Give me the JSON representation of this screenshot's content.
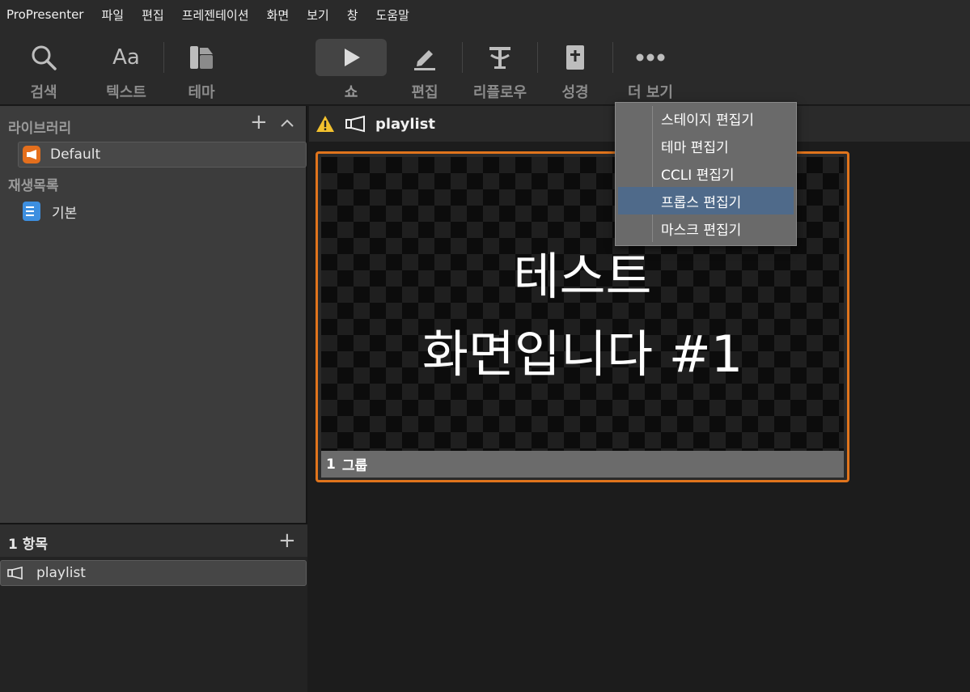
{
  "menubar": {
    "app_name": "ProPresenter",
    "items": [
      "파일",
      "편집",
      "프레젠테이션",
      "화면",
      "보기",
      "창",
      "도움말"
    ]
  },
  "toolbar": {
    "search": {
      "label": "검색",
      "icon": "search-icon"
    },
    "text": {
      "label": "텍스트",
      "icon_text": "Aa"
    },
    "theme": {
      "label": "테마",
      "icon": "theme-icon"
    },
    "show": {
      "label": "쇼",
      "icon": "play-icon"
    },
    "edit": {
      "label": "편집",
      "icon": "pencil-icon"
    },
    "reflow": {
      "label": "리플로우",
      "icon": "reflow-icon"
    },
    "bible": {
      "label": "성경",
      "icon": "bible-icon"
    },
    "more": {
      "label": "더 보기",
      "icon": "more-icon"
    }
  },
  "library": {
    "header": "라이브러리",
    "items": [
      {
        "label": "Default",
        "icon": "library-icon",
        "color": "#e46f1d"
      }
    ]
  },
  "playlists": {
    "header": "재생목록",
    "items": [
      {
        "label": "기본",
        "icon": "playlist-icon",
        "color": "#3d8fe0"
      }
    ]
  },
  "items_pane": {
    "header": "1 항목",
    "items": [
      {
        "label": "playlist",
        "icon": "presentation-icon"
      }
    ]
  },
  "main": {
    "title": "playlist",
    "warning_icon": "warning-icon",
    "slide": {
      "line1": "테스트",
      "line2": "화면입니다 #1",
      "number": "1",
      "group": "그룹",
      "border_color": "#e0741c"
    }
  },
  "dropdown": {
    "items": [
      "스테이지 편집기",
      "테마 편집기",
      "CCLI 편집기",
      "프롭스 편집기",
      "마스크 편집기"
    ],
    "highlighted": "프롭스 편집기"
  }
}
